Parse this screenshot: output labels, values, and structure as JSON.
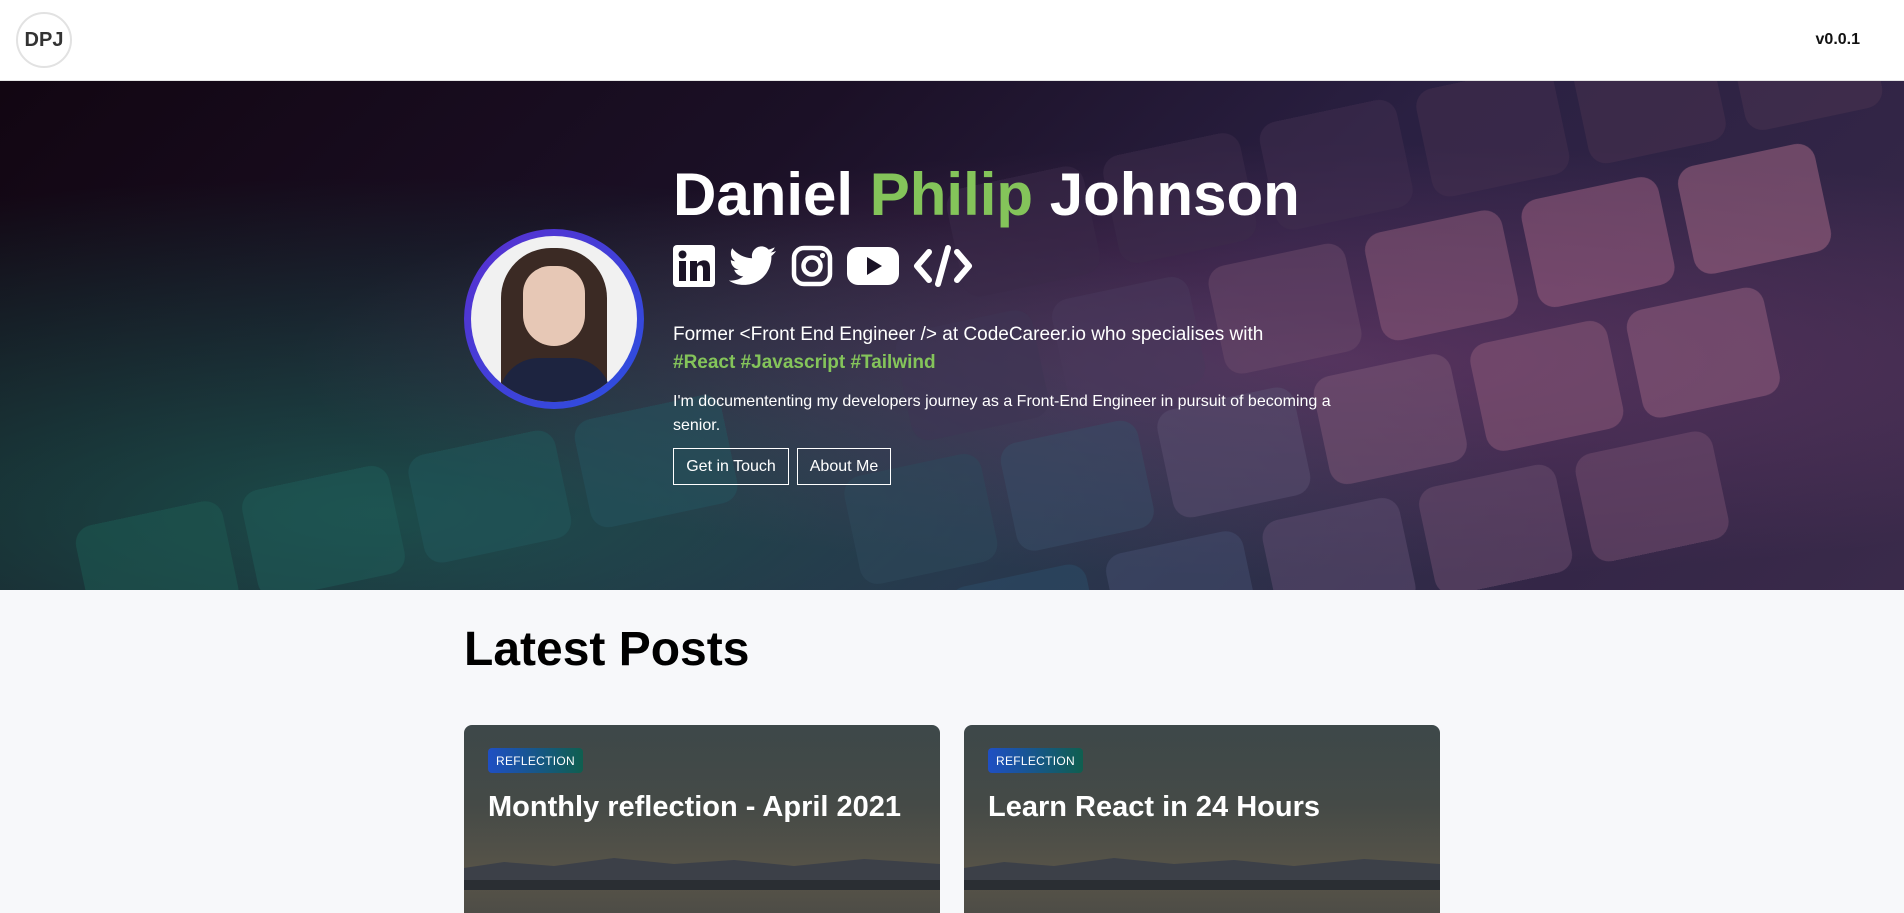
{
  "header": {
    "logo_text": "DPJ",
    "version": "v0.0.1"
  },
  "hero": {
    "name_first": "Daniel",
    "name_middle": "Philip",
    "name_last": "Johnson",
    "socials": [
      {
        "icon": "linkedin-icon"
      },
      {
        "icon": "twitter-icon"
      },
      {
        "icon": "instagram-icon"
      },
      {
        "icon": "youtube-icon"
      },
      {
        "icon": "code-icon"
      }
    ],
    "intro": "Former <Front End Engineer /> at CodeCareer.io who specialises with",
    "tags": "#React #Javascript #Tailwind",
    "journey": "I'm documententing my developers journey as a Front-End Engineer in pursuit of becoming a senior.",
    "buttons": {
      "contact": "Get in Touch",
      "about": "About Me"
    }
  },
  "posts": {
    "title": "Latest Posts",
    "items": [
      {
        "category": "REFLECTION",
        "title": "Monthly reflection - April 2021"
      },
      {
        "category": "REFLECTION",
        "title": "Learn React in 24 Hours"
      }
    ]
  },
  "colors": {
    "accent_green": "#84c45a",
    "avatar_ring": "#4a3bd8",
    "badge_start": "#1f4fc4",
    "badge_end": "#0f5f4f"
  }
}
